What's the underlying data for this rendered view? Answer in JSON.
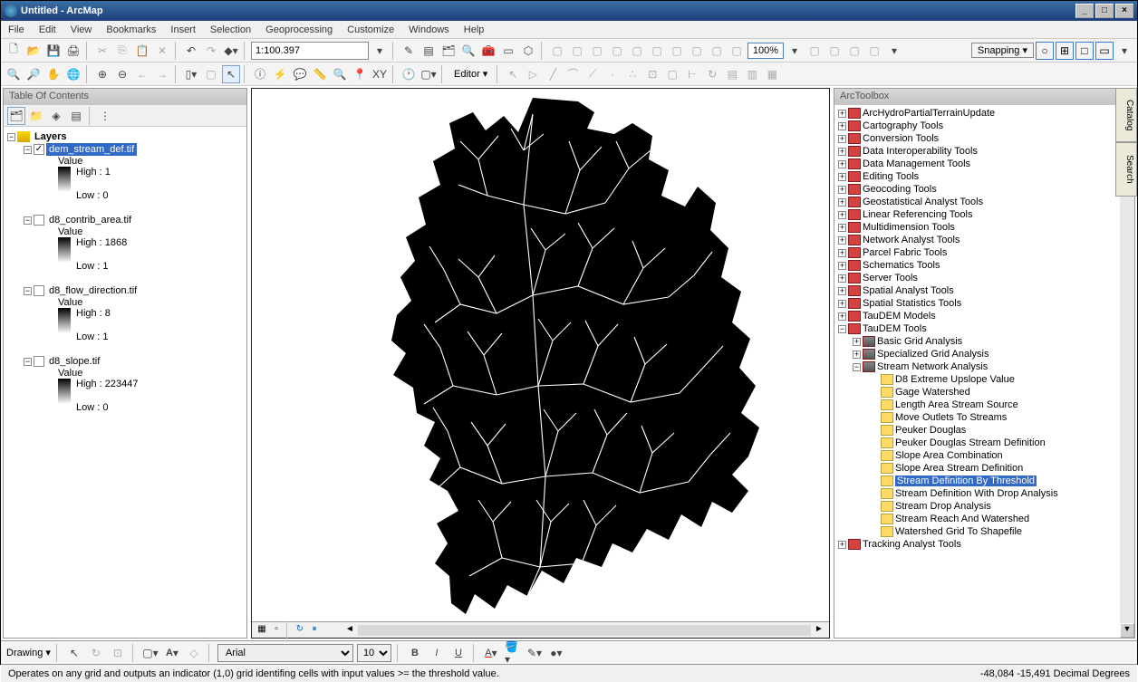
{
  "title": "Untitled - ArcMap",
  "menu": [
    "File",
    "Edit",
    "View",
    "Bookmarks",
    "Insert",
    "Selection",
    "Geoprocessing",
    "Customize",
    "Windows",
    "Help"
  ],
  "scale": "1:100.397",
  "zoom": "100%",
  "snapping": "Snapping",
  "editor": "Editor",
  "drawing": "Drawing",
  "font": "Arial",
  "fontSize": "10",
  "toc": {
    "title": "Table Of Contents",
    "root": "Layers",
    "layers": [
      {
        "name": "dem_stream_def.tif",
        "checked": true,
        "selected": true,
        "high": "High : 1",
        "low": "Low : 0"
      },
      {
        "name": "d8_contrib_area.tif",
        "checked": false,
        "selected": false,
        "high": "High : 1868",
        "low": "Low : 1"
      },
      {
        "name": "d8_flow_direction.tif",
        "checked": false,
        "selected": false,
        "high": "High : 8",
        "low": "Low : 1"
      },
      {
        "name": "d8_slope.tif",
        "checked": false,
        "selected": false,
        "high": "High : 223447",
        "low": "Low : 0"
      }
    ],
    "valueLabel": "Value"
  },
  "arctoolbox": {
    "title": "ArcToolbox",
    "toolboxes": [
      "ArcHydroPartialTerrainUpdate",
      "Cartography Tools",
      "Conversion Tools",
      "Data Interoperability Tools",
      "Data Management Tools",
      "Editing Tools",
      "Geocoding Tools",
      "Geostatistical Analyst Tools",
      "Linear Referencing Tools",
      "Multidimension Tools",
      "Network Analyst Tools",
      "Parcel Fabric Tools",
      "Schematics Tools",
      "Server Tools",
      "Spatial Analyst Tools",
      "Spatial Statistics Tools",
      "TauDEM Models"
    ],
    "taudem": {
      "name": "TauDEM Tools",
      "sets": [
        "Basic Grid Analysis",
        "Specialized Grid Analysis"
      ],
      "streamNet": "Stream Network Analysis",
      "tools": [
        "D8 Extreme Upslope Value",
        "Gage Watershed",
        "Length Area Stream Source",
        "Move Outlets To Streams",
        "Peuker Douglas",
        "Peuker Douglas Stream Definition",
        "Slope Area Combination",
        "Slope Area Stream Definition",
        "Stream Definition By Threshold",
        "Stream Definition With Drop Analysis",
        "Stream Drop Analysis",
        "Stream Reach And Watershed",
        "Watershed Grid To Shapefile"
      ],
      "selectedTool": "Stream Definition By Threshold"
    },
    "tracking": "Tracking Analyst Tools"
  },
  "sideTabs": [
    "Catalog",
    "Search"
  ],
  "status": {
    "msg": "Operates on any grid and outputs an indicator (1,0) grid identifing cells with input values >= the threshold value.",
    "coords": "-48,084  -15,491 Decimal Degrees"
  }
}
